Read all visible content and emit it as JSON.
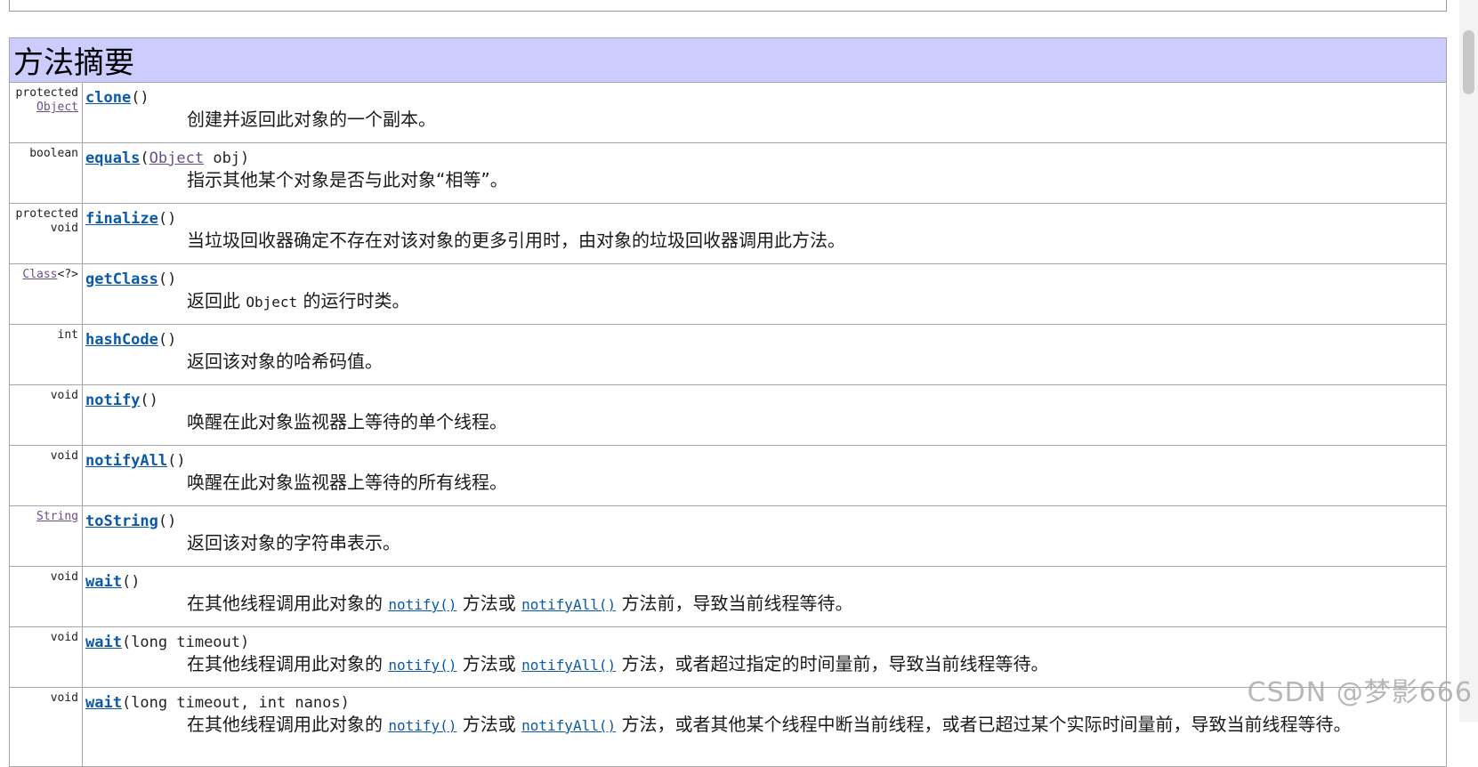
{
  "section_title": "方法摘要",
  "methods": [
    {
      "mod1": "protected",
      "type_link": "Object",
      "name": "clone",
      "sig": "()",
      "desc": "创建并返回此对象的一个副本。"
    },
    {
      "type": "boolean",
      "name": "equals",
      "sig_open": "(",
      "param_type": "Object",
      "sig_rest": " obj)",
      "desc": "指示其他某个对象是否与此对象“相等”。"
    },
    {
      "mod1": "protected",
      "type": "void",
      "name": "finalize",
      "sig": "()",
      "desc": "当垃圾回收器确定不存在对该对象的更多引用时，由对象的垃圾回收器调用此方法。"
    },
    {
      "type_link": "Class",
      "type_suffix": "<?>",
      "name": "getClass",
      "sig": "()",
      "desc_a": "返回此 ",
      "desc_code": "Object",
      "desc_b": " 的运行时类。"
    },
    {
      "type": "int",
      "name": "hashCode",
      "sig": "()",
      "desc": "返回该对象的哈希码值。"
    },
    {
      "type": "void",
      "name": "notify",
      "sig": "()",
      "desc": "唤醒在此对象监视器上等待的单个线程。"
    },
    {
      "type": "void",
      "name": "notifyAll",
      "sig": "()",
      "desc": "唤醒在此对象监视器上等待的所有线程。"
    },
    {
      "type_link": "String",
      "name": "toString",
      "sig": "()",
      "desc": "返回该对象的字符串表示。"
    },
    {
      "type": "void",
      "name": "wait",
      "sig": "()",
      "desc_a": "在其他线程调用此对象的 ",
      "link1": "notify()",
      "desc_b": " 方法或 ",
      "link2": "notifyAll()",
      "desc_c": " 方法前，导致当前线程等待。"
    },
    {
      "type": "void",
      "name": "wait",
      "sig": "(long timeout)",
      "desc_a": "在其他线程调用此对象的 ",
      "link1": "notify()",
      "desc_b": " 方法或 ",
      "link2": "notifyAll()",
      "desc_c": " 方法，或者超过指定的时间量前，导致当前线程等待。"
    },
    {
      "type": "void",
      "name": "wait",
      "sig": "(long timeout, int nanos)",
      "desc_a": "在其他线程调用此对象的 ",
      "link1": "notify()",
      "desc_b": " 方法或 ",
      "link2": "notifyAll()",
      "desc_c": " 方法，或者其他某个线程中断当前线程，或者已超过某个实际时间量前，导致当前线程等待。"
    }
  ],
  "watermark": "CSDN @梦影666"
}
